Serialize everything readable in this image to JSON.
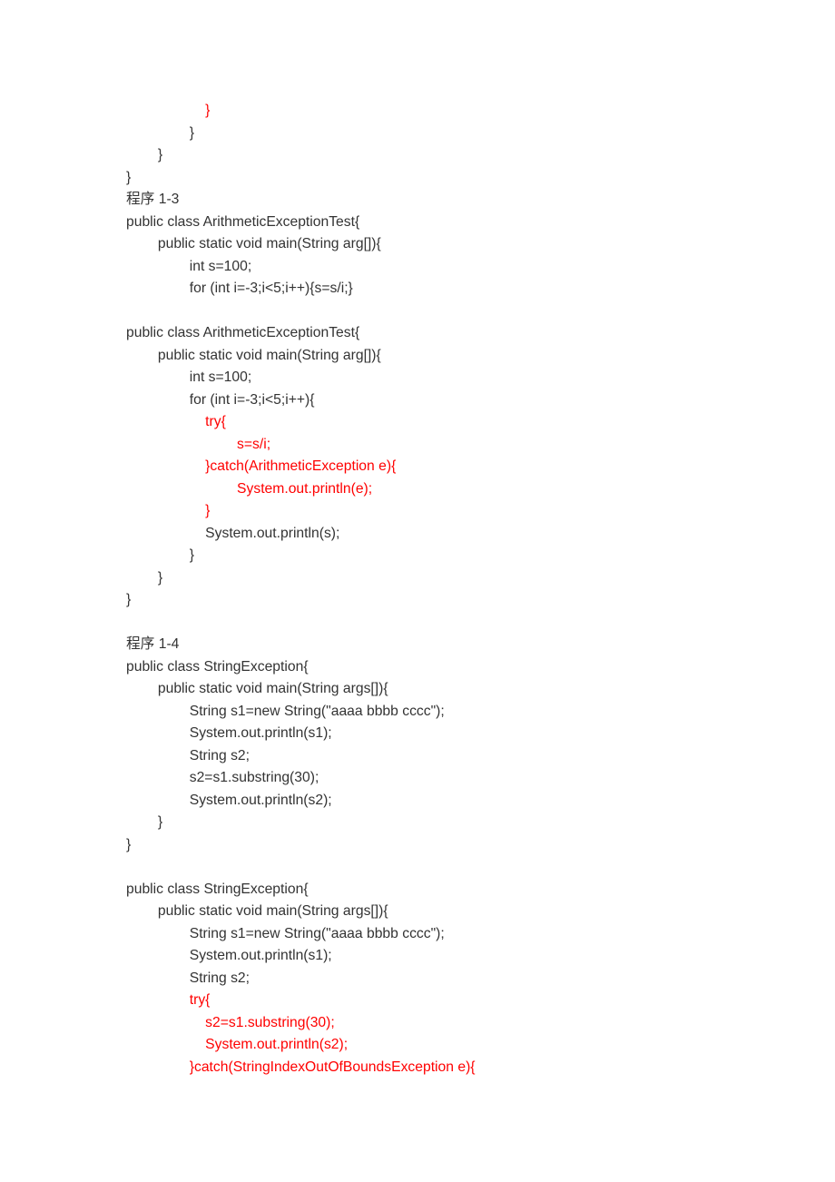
{
  "lines": [
    {
      "indent": 5,
      "r": true,
      "t": "}"
    },
    {
      "indent": 4,
      "t": "}"
    },
    {
      "indent": 2,
      "t": "}"
    },
    {
      "indent": 0,
      "t": "}"
    },
    {
      "indent": 0,
      "cn": true,
      "mixed": [
        {
          "t": "程序",
          "cn": true
        },
        {
          "t": " 1-3"
        }
      ]
    },
    {
      "indent": 0,
      "t": "public class ArithmeticExceptionTest{"
    },
    {
      "indent": 2,
      "t": "public static void main(String arg[]){"
    },
    {
      "indent": 4,
      "t": "int s=100;"
    },
    {
      "indent": 4,
      "t": "for (int i=-3;i<5;i++){s=s/i;}"
    },
    {
      "blank": true
    },
    {
      "indent": 0,
      "t": "public class ArithmeticExceptionTest{"
    },
    {
      "indent": 2,
      "t": "public static void main(String arg[]){"
    },
    {
      "indent": 4,
      "t": "int s=100;"
    },
    {
      "indent": 4,
      "t": "for (int i=-3;i<5;i++){"
    },
    {
      "indent": 5,
      "r": true,
      "t": "try{"
    },
    {
      "indent": 7,
      "r": true,
      "t": "s=s/i;"
    },
    {
      "indent": 5,
      "r": true,
      "t": "}catch(ArithmeticException e){"
    },
    {
      "indent": 7,
      "r": true,
      "t": "System.out.println(e);"
    },
    {
      "indent": 5,
      "r": true,
      "t": "}"
    },
    {
      "indent": 5,
      "t": "System.out.println(s);"
    },
    {
      "indent": 4,
      "t": "}"
    },
    {
      "indent": 2,
      "t": "}"
    },
    {
      "indent": 0,
      "t": "}"
    },
    {
      "blank": true
    },
    {
      "indent": 0,
      "mixed": [
        {
          "t": "程序",
          "cn": true
        },
        {
          "t": " 1-4"
        }
      ]
    },
    {
      "indent": 0,
      "t": "public class StringException{"
    },
    {
      "indent": 2,
      "t": "public static void main(String args[]){"
    },
    {
      "indent": 4,
      "t": "String s1=new String(\"aaaa bbbb cccc\");"
    },
    {
      "indent": 4,
      "t": "System.out.println(s1);"
    },
    {
      "indent": 4,
      "t": "String s2;"
    },
    {
      "indent": 4,
      "t": "s2=s1.substring(30);"
    },
    {
      "indent": 4,
      "t": "System.out.println(s2);"
    },
    {
      "indent": 2,
      "t": "}"
    },
    {
      "indent": 0,
      "t": "}"
    },
    {
      "blank": true
    },
    {
      "indent": 0,
      "t": "public class StringException{"
    },
    {
      "indent": 2,
      "t": "public static void main(String args[]){"
    },
    {
      "indent": 4,
      "t": "String s1=new String(\"aaaa bbbb cccc\");"
    },
    {
      "indent": 4,
      "t": "System.out.println(s1);"
    },
    {
      "indent": 4,
      "t": "String s2;"
    },
    {
      "indent": 4,
      "r": true,
      "t": "try{"
    },
    {
      "indent": 5,
      "r": true,
      "t": "s2=s1.substring(30);"
    },
    {
      "indent": 5,
      "r": true,
      "t": "System.out.println(s2);"
    },
    {
      "indent": 4,
      "r": true,
      "t": "}catch(StringIndexOutOfBoundsException e){"
    }
  ]
}
